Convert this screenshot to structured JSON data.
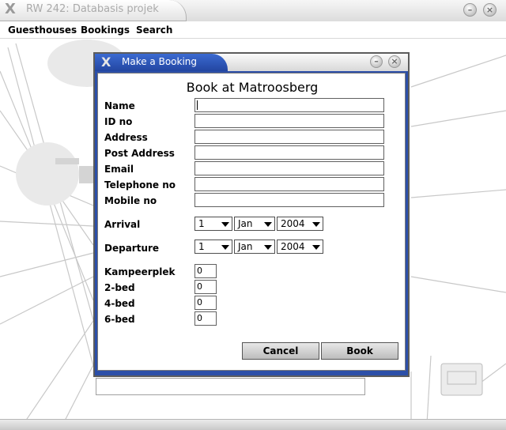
{
  "window": {
    "title": "RW 242: Databasis projek"
  },
  "menu": {
    "items": [
      "Guesthouses",
      "Bookings",
      "Search"
    ]
  },
  "dialog": {
    "title": "Make a Booking",
    "heading": "Book at Matroosberg",
    "fields": [
      {
        "label": "Name",
        "value": ""
      },
      {
        "label": "ID no",
        "value": ""
      },
      {
        "label": "Address",
        "value": ""
      },
      {
        "label": "Post Address",
        "value": ""
      },
      {
        "label": "Email",
        "value": ""
      },
      {
        "label": "Telephone no",
        "value": ""
      },
      {
        "label": "Mobile no",
        "value": ""
      }
    ],
    "arrival": {
      "label": "Arrival",
      "day": "1",
      "month": "Jan",
      "year": "2004"
    },
    "departure": {
      "label": "Departure",
      "day": "1",
      "month": "Jan",
      "year": "2004"
    },
    "rooms": [
      {
        "label": "Kampeerplek",
        "value": "0"
      },
      {
        "label": "2-bed",
        "value": "0"
      },
      {
        "label": "4-bed",
        "value": "0"
      },
      {
        "label": "6-bed",
        "value": "0"
      }
    ],
    "cancel_label": "Cancel",
    "book_label": "Book"
  },
  "icons": {
    "window_logo": "x-logo-icon",
    "minimize": "minimize-icon",
    "close": "close-icon"
  },
  "colors": {
    "dialog_title_accent": "#2c4fa8",
    "dialog_border": "#5c5c5c"
  }
}
